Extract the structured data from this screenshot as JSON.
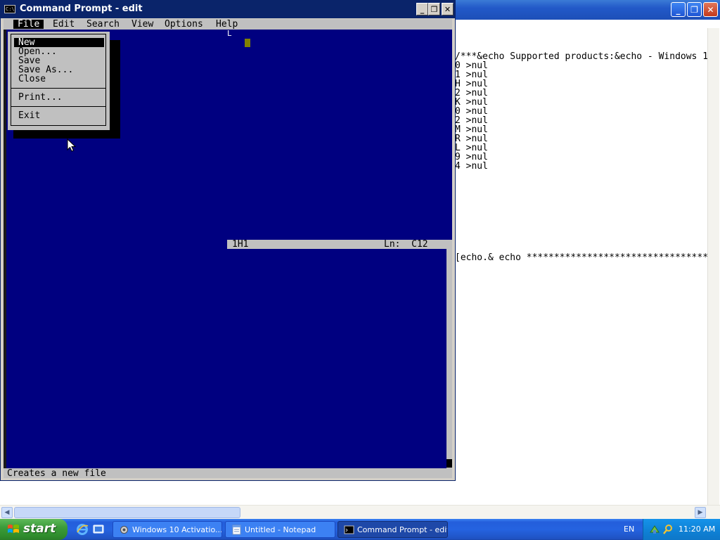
{
  "notepad": {
    "text_lines": [
      "/***&echo Supported products:&echo - Windows 1",
      "0 >nul",
      "1 >nul",
      "H >nul",
      "2 >nul",
      "K >nul",
      "0 >nul",
      "2 >nul",
      "M >nul",
      "R >nul",
      "L >nul",
      "9 >nul",
      "4 >nul",
      "[echo.& echo *************************************"
    ]
  },
  "cmd": {
    "title": "Command Prompt - edit",
    "icon_text": "C:\\"
  },
  "edit": {
    "menu": {
      "file": "File",
      "edit": "Edit",
      "search": "Search",
      "view": "View",
      "options": "Options",
      "help": "Help"
    },
    "file_menu": {
      "new": "New",
      "open": "Open...",
      "save": "Save",
      "save_as": "Save As...",
      "close": "Close",
      "print": "Print...",
      "exit": "Exit"
    },
    "marker": "L",
    "split": {
      "position": "1H1",
      "line_col": "Ln:  C12"
    },
    "status": "Creates a new file"
  },
  "taskbar": {
    "start": "start",
    "tasks": [
      {
        "label": "Windows 10 Activatio..."
      },
      {
        "label": "Untitled - Notepad"
      },
      {
        "label": "Command Prompt - edit"
      }
    ],
    "language": "EN",
    "clock": "11:20 AM"
  },
  "colors": {
    "console_bg": "#000080",
    "menu_bg": "#c0c0c0",
    "titlebar": "#0a246a",
    "taskbar": "#245edb",
    "start_green": "#3c9b3a"
  }
}
